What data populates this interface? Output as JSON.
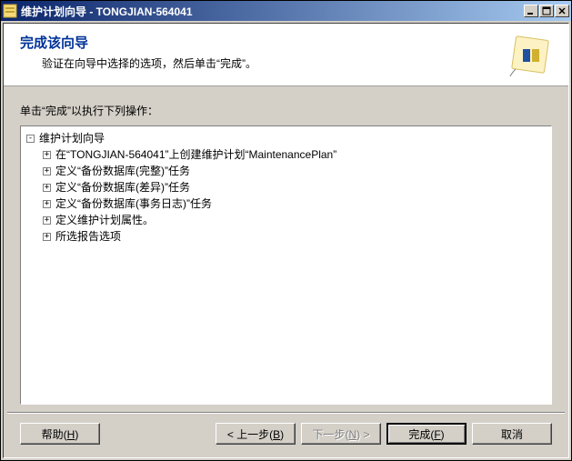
{
  "titlebar": {
    "text": "维护计划向导 - TONGJIAN-564041"
  },
  "header": {
    "title": "完成该向导",
    "subtitle": "验证在向导中选择的选项，然后单击“完成”。"
  },
  "content": {
    "instruction": "单击“完成”以执行下列操作："
  },
  "tree": {
    "root": {
      "label": "维护计划向导",
      "expanded": true,
      "children": [
        {
          "label": "在“TONGJIAN-564041”上创建维护计划“MaintenancePlan”",
          "expanded": false
        },
        {
          "label": "定义“备份数据库(完整)”任务",
          "expanded": false
        },
        {
          "label": "定义“备份数据库(差异)”任务",
          "expanded": false
        },
        {
          "label": "定义“备份数据库(事务日志)”任务",
          "expanded": false
        },
        {
          "label": "定义维护计划属性。",
          "expanded": false
        },
        {
          "label": "所选报告选项",
          "expanded": false
        }
      ]
    }
  },
  "buttons": {
    "help": {
      "label": "帮助",
      "key": "H"
    },
    "back": {
      "label": "< 上一步",
      "key": "B"
    },
    "next": {
      "label": "下一步",
      "key": "N",
      "suffix": " >"
    },
    "finish": {
      "label": "完成",
      "key": "F"
    },
    "cancel": {
      "label": "取消"
    }
  }
}
